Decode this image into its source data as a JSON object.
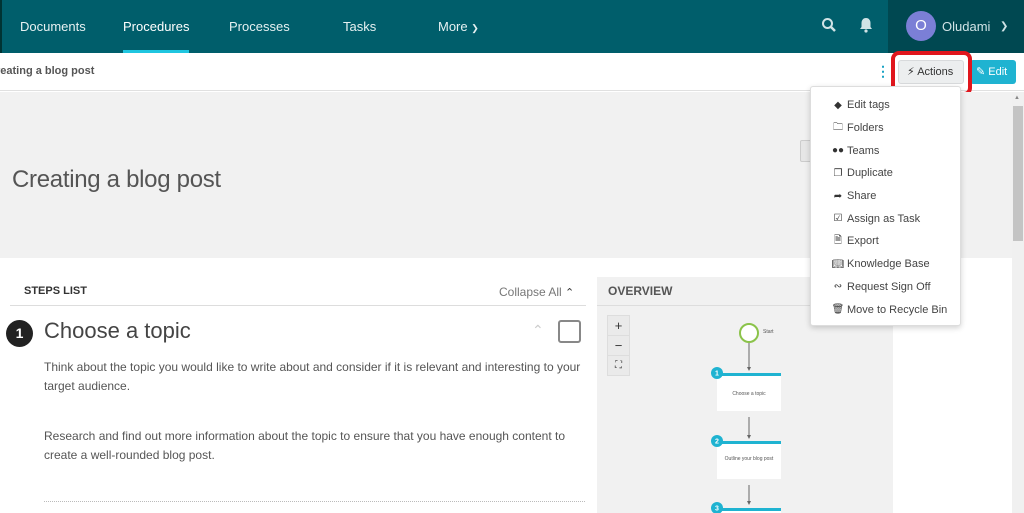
{
  "nav": {
    "items": [
      {
        "label": "Documents"
      },
      {
        "label": "Procedures",
        "active": true
      },
      {
        "label": "Processes"
      },
      {
        "label": "Tasks"
      },
      {
        "label": "More"
      }
    ],
    "search_icon": "search-icon",
    "bell_icon": "bell-icon",
    "user": {
      "initial": "O",
      "name": "Oludami"
    }
  },
  "subbar": {
    "breadcrumb": "reating a blog post",
    "actions_label": "Actions",
    "edit_label": "Edit"
  },
  "hero": {
    "title": "Creating a blog post"
  },
  "actions_menu": {
    "items": [
      {
        "label": "Edit tags",
        "icon": "tag-icon"
      },
      {
        "label": "Folders",
        "icon": "folder-icon"
      },
      {
        "label": "Teams",
        "icon": "users-icon"
      },
      {
        "label": "Duplicate",
        "icon": "copy-icon"
      },
      {
        "label": "Share",
        "icon": "share-icon"
      },
      {
        "label": "Assign as Task",
        "icon": "checkbox-icon"
      },
      {
        "label": "Export",
        "icon": "pdf-file-icon"
      },
      {
        "label": "Knowledge Base",
        "icon": "book-icon"
      },
      {
        "label": "Request Sign Off",
        "icon": "signature-icon"
      },
      {
        "label": "Move to Recycle Bin",
        "icon": "trash-icon"
      }
    ]
  },
  "steps": {
    "header": "STEPS LIST",
    "collapse_label": "Collapse All",
    "items": [
      {
        "number": "1",
        "title": "Choose a topic",
        "paragraphs": [
          "Think about the topic you would like to write about and consider if it is relevant and interesting to your target audience.",
          "Research and find out more information about the topic to ensure that you have enough content to create a well-rounded blog post."
        ]
      }
    ]
  },
  "overview": {
    "header": "OVERVIEW",
    "zoom_in": "+",
    "zoom_out": "−",
    "fit": "⛶",
    "start_label": "Start",
    "nodes": [
      {
        "number": "1",
        "label": "Choose a topic"
      },
      {
        "number": "2",
        "label": "Outline your blog post"
      },
      {
        "number": "3",
        "label": ""
      }
    ]
  }
}
